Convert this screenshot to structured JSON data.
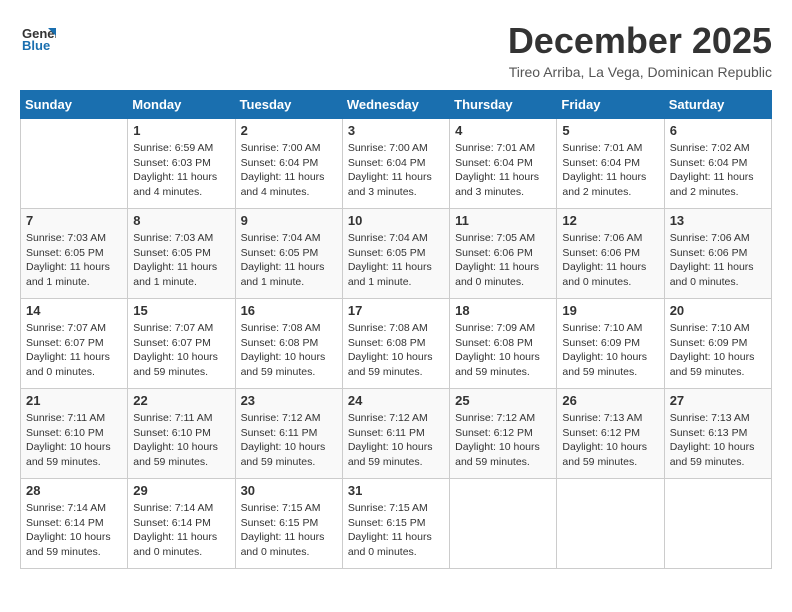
{
  "header": {
    "logo_line1": "General",
    "logo_line2": "Blue",
    "month_title": "December 2025",
    "location": "Tireo Arriba, La Vega, Dominican Republic"
  },
  "days_of_week": [
    "Sunday",
    "Monday",
    "Tuesday",
    "Wednesday",
    "Thursday",
    "Friday",
    "Saturday"
  ],
  "weeks": [
    [
      {
        "num": "",
        "info": ""
      },
      {
        "num": "1",
        "info": "Sunrise: 6:59 AM\nSunset: 6:03 PM\nDaylight: 11 hours\nand 4 minutes."
      },
      {
        "num": "2",
        "info": "Sunrise: 7:00 AM\nSunset: 6:04 PM\nDaylight: 11 hours\nand 4 minutes."
      },
      {
        "num": "3",
        "info": "Sunrise: 7:00 AM\nSunset: 6:04 PM\nDaylight: 11 hours\nand 3 minutes."
      },
      {
        "num": "4",
        "info": "Sunrise: 7:01 AM\nSunset: 6:04 PM\nDaylight: 11 hours\nand 3 minutes."
      },
      {
        "num": "5",
        "info": "Sunrise: 7:01 AM\nSunset: 6:04 PM\nDaylight: 11 hours\nand 2 minutes."
      },
      {
        "num": "6",
        "info": "Sunrise: 7:02 AM\nSunset: 6:04 PM\nDaylight: 11 hours\nand 2 minutes."
      }
    ],
    [
      {
        "num": "7",
        "info": "Sunrise: 7:03 AM\nSunset: 6:05 PM\nDaylight: 11 hours\nand 1 minute."
      },
      {
        "num": "8",
        "info": "Sunrise: 7:03 AM\nSunset: 6:05 PM\nDaylight: 11 hours\nand 1 minute."
      },
      {
        "num": "9",
        "info": "Sunrise: 7:04 AM\nSunset: 6:05 PM\nDaylight: 11 hours\nand 1 minute."
      },
      {
        "num": "10",
        "info": "Sunrise: 7:04 AM\nSunset: 6:05 PM\nDaylight: 11 hours\nand 1 minute."
      },
      {
        "num": "11",
        "info": "Sunrise: 7:05 AM\nSunset: 6:06 PM\nDaylight: 11 hours\nand 0 minutes."
      },
      {
        "num": "12",
        "info": "Sunrise: 7:06 AM\nSunset: 6:06 PM\nDaylight: 11 hours\nand 0 minutes."
      },
      {
        "num": "13",
        "info": "Sunrise: 7:06 AM\nSunset: 6:06 PM\nDaylight: 11 hours\nand 0 minutes."
      }
    ],
    [
      {
        "num": "14",
        "info": "Sunrise: 7:07 AM\nSunset: 6:07 PM\nDaylight: 11 hours\nand 0 minutes."
      },
      {
        "num": "15",
        "info": "Sunrise: 7:07 AM\nSunset: 6:07 PM\nDaylight: 10 hours\nand 59 minutes."
      },
      {
        "num": "16",
        "info": "Sunrise: 7:08 AM\nSunset: 6:08 PM\nDaylight: 10 hours\nand 59 minutes."
      },
      {
        "num": "17",
        "info": "Sunrise: 7:08 AM\nSunset: 6:08 PM\nDaylight: 10 hours\nand 59 minutes."
      },
      {
        "num": "18",
        "info": "Sunrise: 7:09 AM\nSunset: 6:08 PM\nDaylight: 10 hours\nand 59 minutes."
      },
      {
        "num": "19",
        "info": "Sunrise: 7:10 AM\nSunset: 6:09 PM\nDaylight: 10 hours\nand 59 minutes."
      },
      {
        "num": "20",
        "info": "Sunrise: 7:10 AM\nSunset: 6:09 PM\nDaylight: 10 hours\nand 59 minutes."
      }
    ],
    [
      {
        "num": "21",
        "info": "Sunrise: 7:11 AM\nSunset: 6:10 PM\nDaylight: 10 hours\nand 59 minutes."
      },
      {
        "num": "22",
        "info": "Sunrise: 7:11 AM\nSunset: 6:10 PM\nDaylight: 10 hours\nand 59 minutes."
      },
      {
        "num": "23",
        "info": "Sunrise: 7:12 AM\nSunset: 6:11 PM\nDaylight: 10 hours\nand 59 minutes."
      },
      {
        "num": "24",
        "info": "Sunrise: 7:12 AM\nSunset: 6:11 PM\nDaylight: 10 hours\nand 59 minutes."
      },
      {
        "num": "25",
        "info": "Sunrise: 7:12 AM\nSunset: 6:12 PM\nDaylight: 10 hours\nand 59 minutes."
      },
      {
        "num": "26",
        "info": "Sunrise: 7:13 AM\nSunset: 6:12 PM\nDaylight: 10 hours\nand 59 minutes."
      },
      {
        "num": "27",
        "info": "Sunrise: 7:13 AM\nSunset: 6:13 PM\nDaylight: 10 hours\nand 59 minutes."
      }
    ],
    [
      {
        "num": "28",
        "info": "Sunrise: 7:14 AM\nSunset: 6:14 PM\nDaylight: 10 hours\nand 59 minutes."
      },
      {
        "num": "29",
        "info": "Sunrise: 7:14 AM\nSunset: 6:14 PM\nDaylight: 11 hours\nand 0 minutes."
      },
      {
        "num": "30",
        "info": "Sunrise: 7:15 AM\nSunset: 6:15 PM\nDaylight: 11 hours\nand 0 minutes."
      },
      {
        "num": "31",
        "info": "Sunrise: 7:15 AM\nSunset: 6:15 PM\nDaylight: 11 hours\nand 0 minutes."
      },
      {
        "num": "",
        "info": ""
      },
      {
        "num": "",
        "info": ""
      },
      {
        "num": "",
        "info": ""
      }
    ]
  ]
}
